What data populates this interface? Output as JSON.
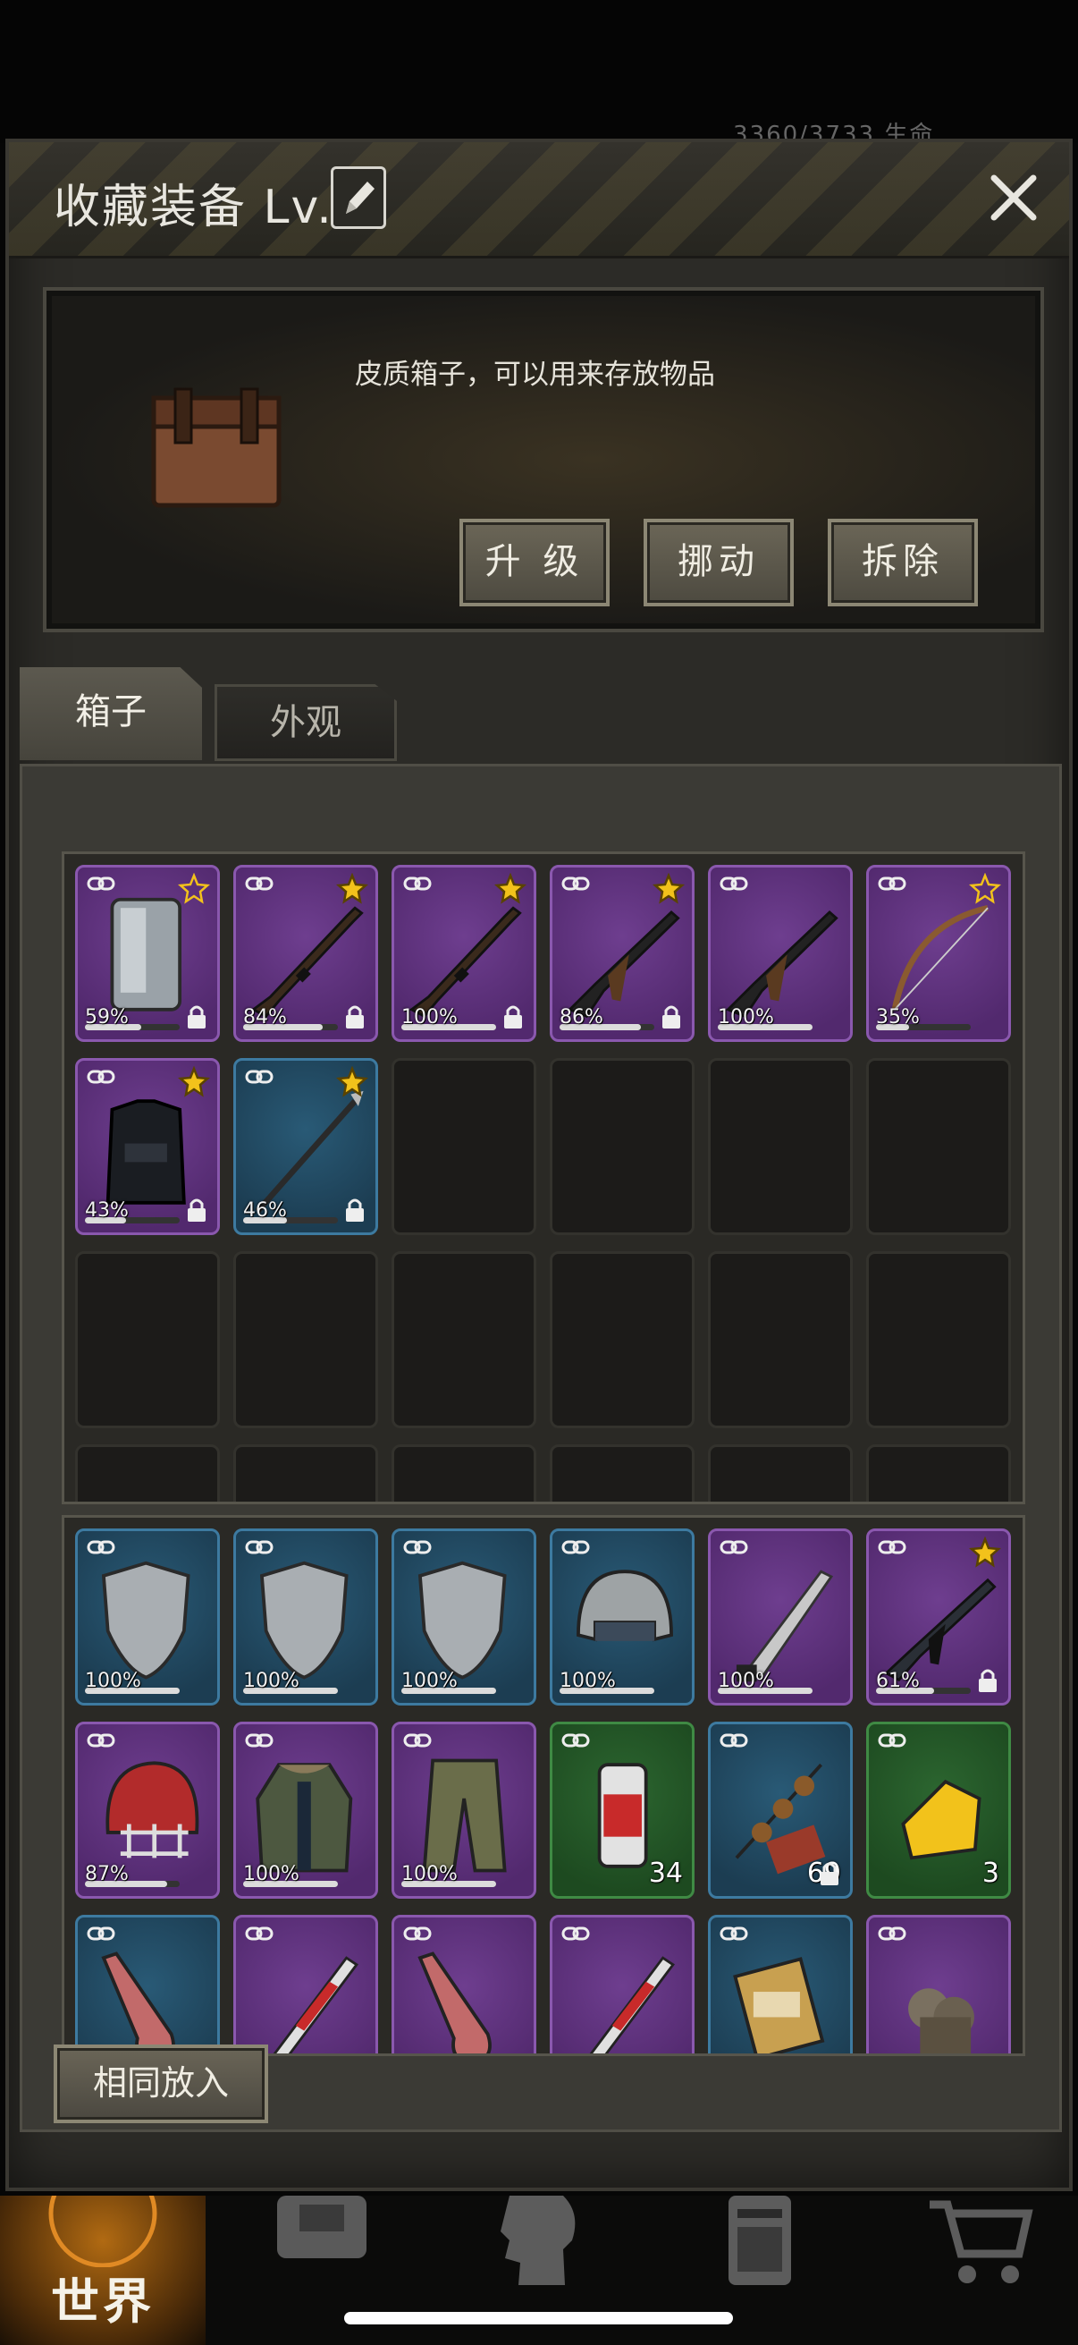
{
  "header": {
    "title": "收藏装备 Lv.3",
    "bg_status": "3360/3733    生命"
  },
  "info": {
    "description": "皮质箱子，可以用来存放物品",
    "buttons": [
      "升 级",
      "挪动",
      "拆除"
    ]
  },
  "tabs": [
    {
      "label": "箱子",
      "active": true
    },
    {
      "label": "外观",
      "active": false
    }
  ],
  "box_items": [
    {
      "name": "riot-shield",
      "color": "purple",
      "pct": "59%",
      "percent": 59,
      "star": true,
      "star_filled": false,
      "lock": true
    },
    {
      "name": "rifle",
      "color": "purple",
      "pct": "84%",
      "percent": 84,
      "star": true,
      "star_filled": true,
      "lock": true
    },
    {
      "name": "rifle",
      "color": "purple",
      "pct": "100%",
      "percent": 100,
      "star": true,
      "star_filled": true,
      "lock": true
    },
    {
      "name": "assault-rifle",
      "color": "purple",
      "pct": "86%",
      "percent": 86,
      "star": true,
      "star_filled": true,
      "lock": true
    },
    {
      "name": "assault-rifle",
      "color": "purple",
      "pct": "100%",
      "percent": 100,
      "star": false,
      "star_filled": false,
      "lock": false
    },
    {
      "name": "bow",
      "color": "purple",
      "pct": "35%",
      "percent": 35,
      "star": true,
      "star_filled": false,
      "lock": false
    },
    {
      "name": "police-vest",
      "color": "purple",
      "pct": "43%",
      "percent": 43,
      "star": true,
      "star_filled": true,
      "lock": true
    },
    {
      "name": "spear",
      "color": "blue",
      "pct": "46%",
      "percent": 46,
      "star": true,
      "star_filled": true,
      "lock": true
    }
  ],
  "inventory_items": [
    {
      "name": "shield",
      "color": "blue",
      "pct": "100%",
      "percent": 100
    },
    {
      "name": "shield",
      "color": "blue",
      "pct": "100%",
      "percent": 100
    },
    {
      "name": "shield",
      "color": "blue",
      "pct": "100%",
      "percent": 100
    },
    {
      "name": "helmet",
      "color": "blue",
      "pct": "100%",
      "percent": 100
    },
    {
      "name": "machete",
      "color": "purple",
      "pct": "100%",
      "percent": 100
    },
    {
      "name": "m16-rifle",
      "color": "purple",
      "pct": "61%",
      "percent": 61,
      "star": true,
      "lock": true
    },
    {
      "name": "football-helmet",
      "color": "purple",
      "pct": "87%",
      "percent": 87
    },
    {
      "name": "winter-coat",
      "color": "purple",
      "pct": "100%",
      "percent": 100
    },
    {
      "name": "cargo-pants",
      "color": "purple",
      "pct": "100%",
      "percent": 100
    },
    {
      "name": "beer-can",
      "color": "green",
      "qty": "34"
    },
    {
      "name": "meat-skewers",
      "color": "blue",
      "qty": "69",
      "lock": true
    },
    {
      "name": "cheese",
      "color": "green",
      "qty": "3"
    },
    {
      "name": "meat-leg",
      "color": "blue"
    },
    {
      "name": "syringe",
      "color": "purple"
    },
    {
      "name": "meat-leg",
      "color": "purple"
    },
    {
      "name": "syringe",
      "color": "purple"
    },
    {
      "name": "battery-pack",
      "color": "blue"
    },
    {
      "name": "gloves",
      "color": "purple"
    }
  ],
  "same_put_button": "相同放入",
  "bottom_nav": [
    {
      "label": "世界",
      "icon": "globe-icon",
      "active": true
    },
    {
      "label": "",
      "icon": "backpack-icon",
      "active": false
    },
    {
      "label": "",
      "icon": "head-gear-icon",
      "active": false
    },
    {
      "label": "",
      "icon": "phone-icon",
      "active": false
    },
    {
      "label": "",
      "icon": "cart-icon",
      "active": false
    }
  ],
  "colors": {
    "purple_rarity": "#52296e",
    "blue_rarity": "#1c3d52",
    "green_rarity": "#1d4a20",
    "star_gold": "#f2c21b",
    "nav_active": "#b16a12"
  }
}
